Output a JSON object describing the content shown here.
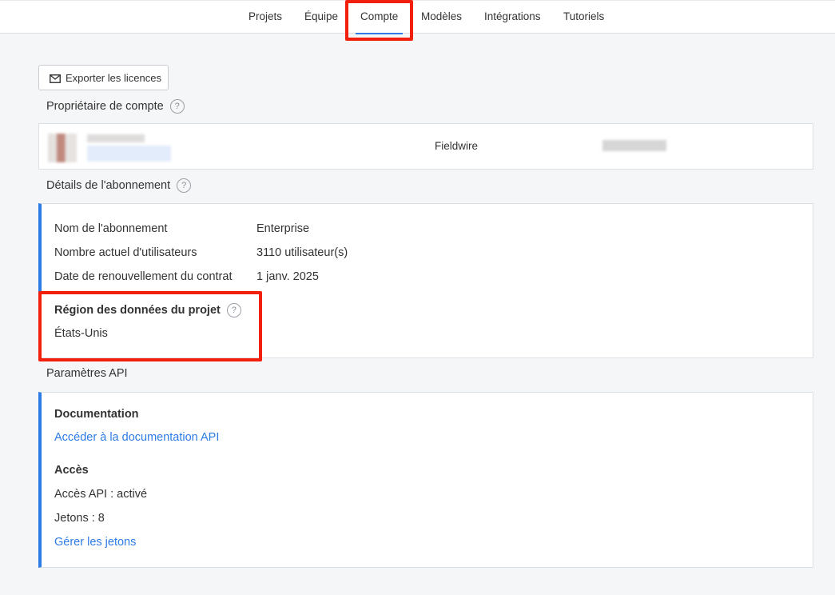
{
  "nav": {
    "tabs": [
      {
        "label": "Projets"
      },
      {
        "label": "Équipe"
      },
      {
        "label": "Compte"
      },
      {
        "label": "Modèles"
      },
      {
        "label": "Intégrations"
      },
      {
        "label": "Tutoriels"
      }
    ],
    "active": "Compte"
  },
  "export_button": {
    "label": "Exporter les licences",
    "icon": "envelope-icon"
  },
  "owner": {
    "section_title": "Propriétaire de compte",
    "company": "Fieldwire"
  },
  "subscription": {
    "section_title": "Détails de l'abonnement",
    "rows": [
      {
        "label": "Nom de l'abonnement",
        "value": "Enterprise"
      },
      {
        "label": "Nombre actuel d'utilisateurs",
        "value": "3110 utilisateur(s)"
      },
      {
        "label": "Date de renouvellement du contrat",
        "value": "1 janv. 2025"
      }
    ],
    "region_title": "Région des données du projet",
    "region_value": "États-Unis"
  },
  "api": {
    "section_title": "Paramètres API",
    "doc_title": "Documentation",
    "doc_link": "Accéder à la documentation API",
    "access_title": "Accès",
    "access_status": "Accès API : activé",
    "tokens": "Jetons : 8",
    "manage_link": "Gérer les jetons"
  },
  "colors": {
    "accent": "#2d7be5",
    "highlight": "#f21f0d"
  }
}
